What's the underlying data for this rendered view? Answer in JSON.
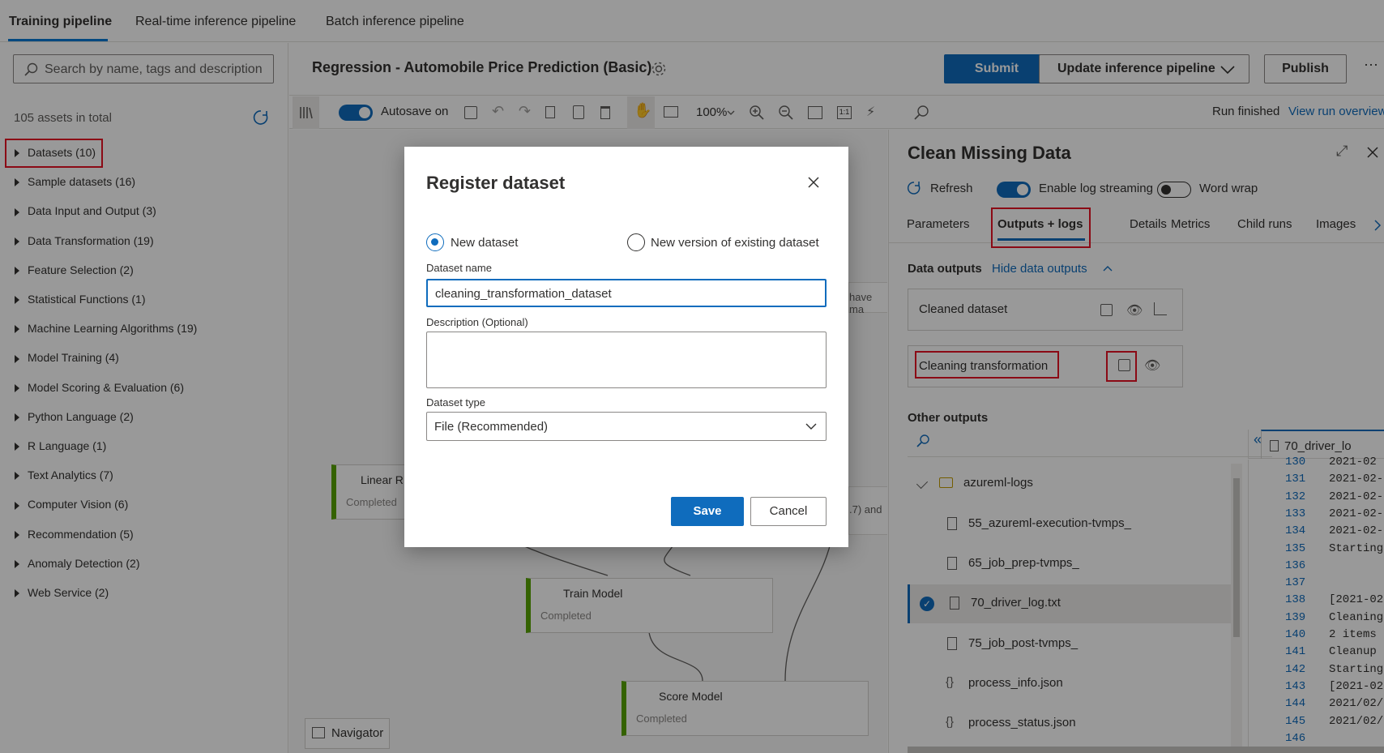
{
  "tabs": [
    "Training pipeline",
    "Real-time inference pipeline",
    "Batch inference pipeline"
  ],
  "search": {
    "placeholder": "Search by name, tags and description"
  },
  "assets_total": "105 assets in total",
  "tree": [
    "Datasets (10)",
    "Sample datasets (16)",
    "Data Input and Output (3)",
    "Data Transformation (19)",
    "Feature Selection (2)",
    "Statistical Functions (1)",
    "Machine Learning Algorithms (19)",
    "Model Training (4)",
    "Model Scoring & Evaluation (6)",
    "Python Language (2)",
    "R Language (1)",
    "Text Analytics (7)",
    "Computer Vision (6)",
    "Recommendation (5)",
    "Anomaly Detection (2)",
    "Web Service (2)"
  ],
  "pipeline_title": "Regression - Automobile Price Prediction (Basic)",
  "buttons": {
    "submit": "Submit",
    "update": "Update inference pipeline",
    "publish": "Publish",
    "more": "···"
  },
  "toolbar": {
    "autosave": "Autosave on",
    "zoom": "100%",
    "run_status": "Run finished",
    "view_run": "View run overview"
  },
  "canvas": {
    "navigator": "Navigator",
    "linear": "Linear R",
    "linear_status": "Completed",
    "train": "Train Model",
    "train_status": "Completed",
    "score": "Score Model",
    "score_status": "Completed",
    "snippet1": "have ma",
    "snippet2": ".7) and"
  },
  "panel": {
    "title": "Clean Missing Data",
    "refresh": "Refresh",
    "enable_log": "Enable log streaming",
    "word_wrap": "Word wrap",
    "tabs": [
      "Parameters",
      "Outputs + logs",
      "Details",
      "Metrics",
      "Child runs",
      "Images"
    ],
    "data_outputs": "Data outputs",
    "hide_data": "Hide data outputs",
    "out1": "Cleaned dataset",
    "out2": "Cleaning transformation",
    "other_outputs": "Other outputs",
    "folder": "azureml-logs",
    "files": [
      "55_azureml-execution-tvmps_",
      "65_job_prep-tvmps_",
      "70_driver_log.txt",
      "75_job_post-tvmps_",
      "process_info.json",
      "process_status.json"
    ],
    "log_tab": "70_driver_lo",
    "log_lines": [
      {
        "n": "130",
        "t": "2021-02"
      },
      {
        "n": "131",
        "t": "2021-02-"
      },
      {
        "n": "132",
        "t": "2021-02-"
      },
      {
        "n": "133",
        "t": "2021-02-"
      },
      {
        "n": "134",
        "t": "2021-02-"
      },
      {
        "n": "135",
        "t": "Starting"
      },
      {
        "n": "136",
        "t": ""
      },
      {
        "n": "137",
        "t": ""
      },
      {
        "n": "138",
        "t": "[2021-02"
      },
      {
        "n": "139",
        "t": "Cleaning"
      },
      {
        "n": "140",
        "t": "2 items"
      },
      {
        "n": "141",
        "t": "Cleanup"
      },
      {
        "n": "142",
        "t": "Starting"
      },
      {
        "n": "143",
        "t": "[2021-02"
      },
      {
        "n": "144",
        "t": "2021/02/"
      },
      {
        "n": "145",
        "t": "2021/02/"
      },
      {
        "n": "146",
        "t": ""
      }
    ]
  },
  "dialog": {
    "title": "Register dataset",
    "radio_new": "New dataset",
    "radio_existing": "New version of existing dataset",
    "name_label": "Dataset name",
    "name_value": "cleaning_transformation_dataset",
    "desc_label": "Description (Optional)",
    "desc_value": "",
    "type_label": "Dataset type",
    "type_value": "File (Recommended)",
    "save": "Save",
    "cancel": "Cancel"
  },
  "colors": {
    "accent": "#0f6cbd",
    "highlight": "#e81123",
    "node_status": "#57a300"
  }
}
